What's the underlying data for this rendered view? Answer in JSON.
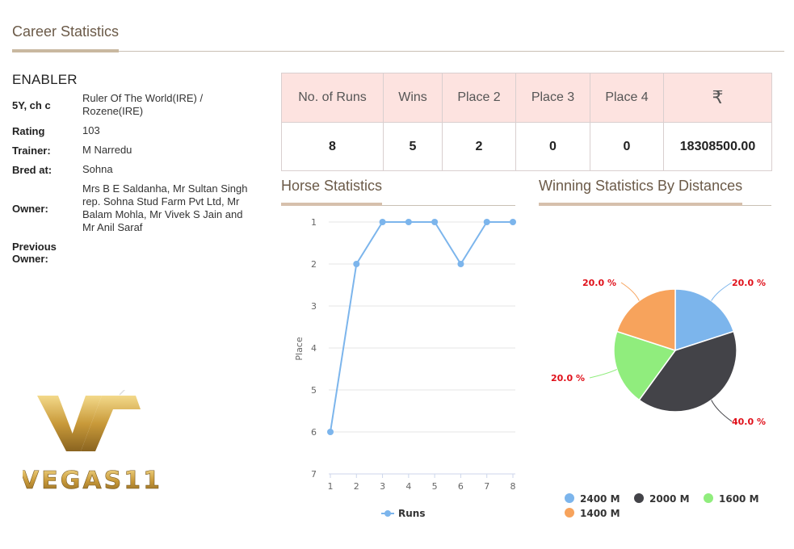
{
  "section": {
    "title": "Career Statistics"
  },
  "horse": {
    "name": "ENABLER",
    "details": [
      {
        "label": "5Y, ch c",
        "value": "Ruler Of The World(IRE) / Rozene(IRE)"
      },
      {
        "label": "Rating",
        "value": "103"
      },
      {
        "label": "Trainer:",
        "value": "M Narredu"
      },
      {
        "label": "Bred at:",
        "value": "Sohna"
      },
      {
        "label": "Owner:",
        "value": "Mrs B E Saldanha, Mr Sultan Singh rep. Sohna Stud Farm Pvt Ltd, Mr Balam Mohla, Mr Vivek S Jain and Mr Anil Saraf"
      },
      {
        "label": "Previous Owner:",
        "value": ""
      }
    ]
  },
  "logo": {
    "text": "VEGAS11"
  },
  "stats_table": {
    "headers": [
      "No. of Runs",
      "Wins",
      "Place 2",
      "Place 3",
      "Place 4",
      "₹"
    ],
    "values": [
      "8",
      "5",
      "2",
      "0",
      "0",
      "18308500.00"
    ]
  },
  "horse_statistics": {
    "title": "Horse Statistics"
  },
  "winning_statistics": {
    "title": "Winning Statistics By Distances"
  },
  "chart_data": [
    {
      "type": "line",
      "title": "Horse Statistics",
      "xlabel": "",
      "ylabel": "Place",
      "x": [
        1,
        2,
        3,
        4,
        5,
        6,
        7,
        8
      ],
      "series": [
        {
          "name": "Runs",
          "values": [
            6,
            2,
            1,
            1,
            1,
            2,
            1,
            1
          ],
          "color": "#7cb5ec"
        }
      ],
      "ylim": [
        1,
        7
      ],
      "y_reversed": true,
      "yticks": [
        1,
        2,
        3,
        4,
        5,
        6,
        7
      ],
      "xticks": [
        1,
        2,
        3,
        4,
        5,
        6,
        7,
        8
      ],
      "grid": true,
      "legend": "bottom-center"
    },
    {
      "type": "pie",
      "title": "Winning Statistics By Distances",
      "slices": [
        {
          "label": "2400 M",
          "value": 20.0,
          "color": "#7cb5ec",
          "data_label": "20.0 %"
        },
        {
          "label": "2000 M",
          "value": 40.0,
          "color": "#434348",
          "data_label": "40.0 %"
        },
        {
          "label": "1600 M",
          "value": 20.0,
          "color": "#90ed7d",
          "data_label": "20.0 %"
        },
        {
          "label": "1400 M",
          "value": 20.0,
          "color": "#f7a35c",
          "data_label": "20.0 %"
        }
      ],
      "label_color": "#e0101a",
      "legend": "bottom"
    }
  ]
}
